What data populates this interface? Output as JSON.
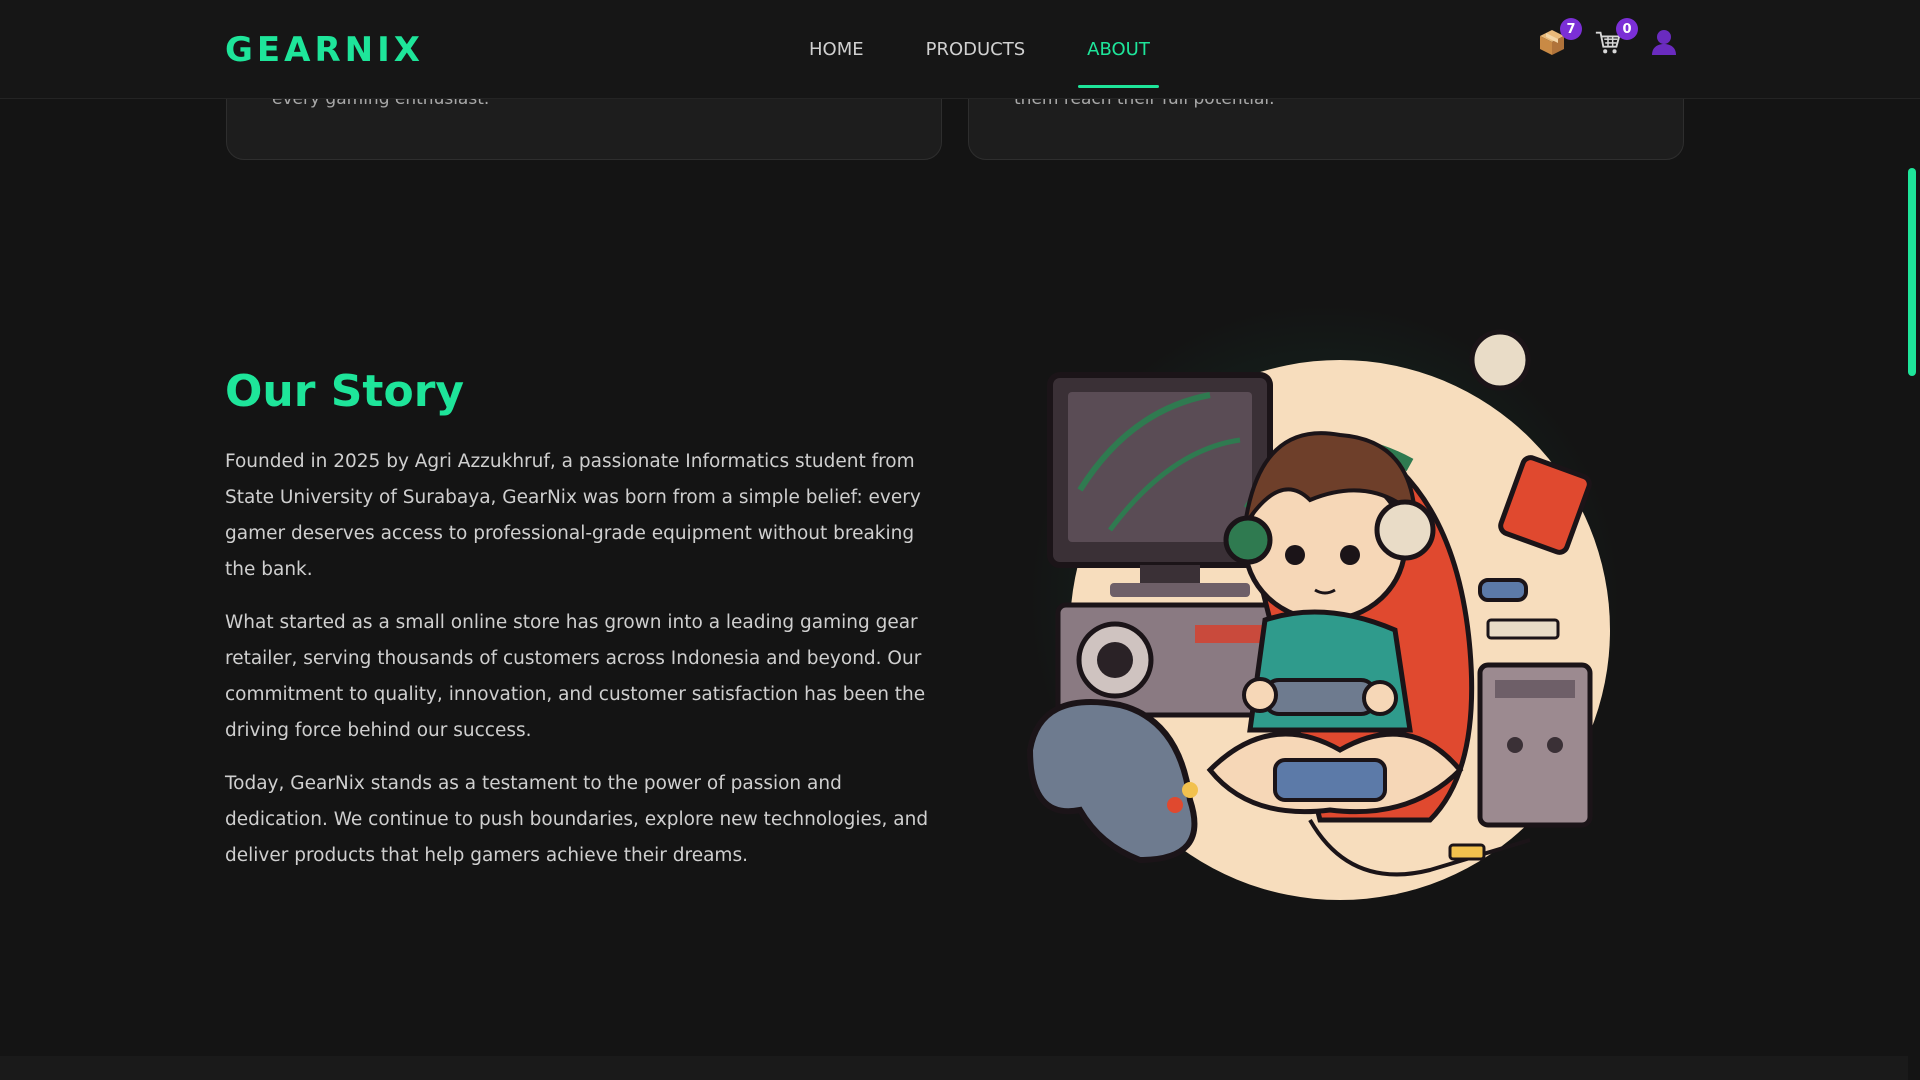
{
  "header": {
    "logo": "GEARNIX",
    "nav": [
      {
        "label": "HOME",
        "active": false
      },
      {
        "label": "PRODUCTS",
        "active": false
      },
      {
        "label": "ABOUT",
        "active": true
      }
    ],
    "icons": {
      "orders": {
        "icon": "package-icon",
        "count": "7"
      },
      "cart": {
        "icon": "cart-icon",
        "count": "0"
      },
      "account": {
        "icon": "user-icon"
      }
    }
  },
  "cards": [
    {
      "text": "every gaming enthusiast."
    },
    {
      "text": "them reach their full potential."
    }
  ],
  "story": {
    "title": "Our Story",
    "paragraphs": [
      "Founded in 2025 by Agri Azzukhruf, a passionate Informatics student from State University of Surabaya, GearNix was born from a simple belief: every gamer deserves access to professional-grade equipment without breaking the bank.",
      "What started as a small online store has grown into a leading gaming gear retailer, serving thousands of customers across Indonesia and beyond. Our commitment to quality, innovation, and customer satisfaction has been the driving force behind our success.",
      "Today, GearNix stands as a testament to the power of passion and dedication. We continue to push boundaries, explore new technologies, and deliver products that help gamers achieve their dreams."
    ],
    "image": "gamer-illustration"
  },
  "colors": {
    "accent": "#1ee59a",
    "badge": "#7b2fd6",
    "background": "#141414"
  }
}
